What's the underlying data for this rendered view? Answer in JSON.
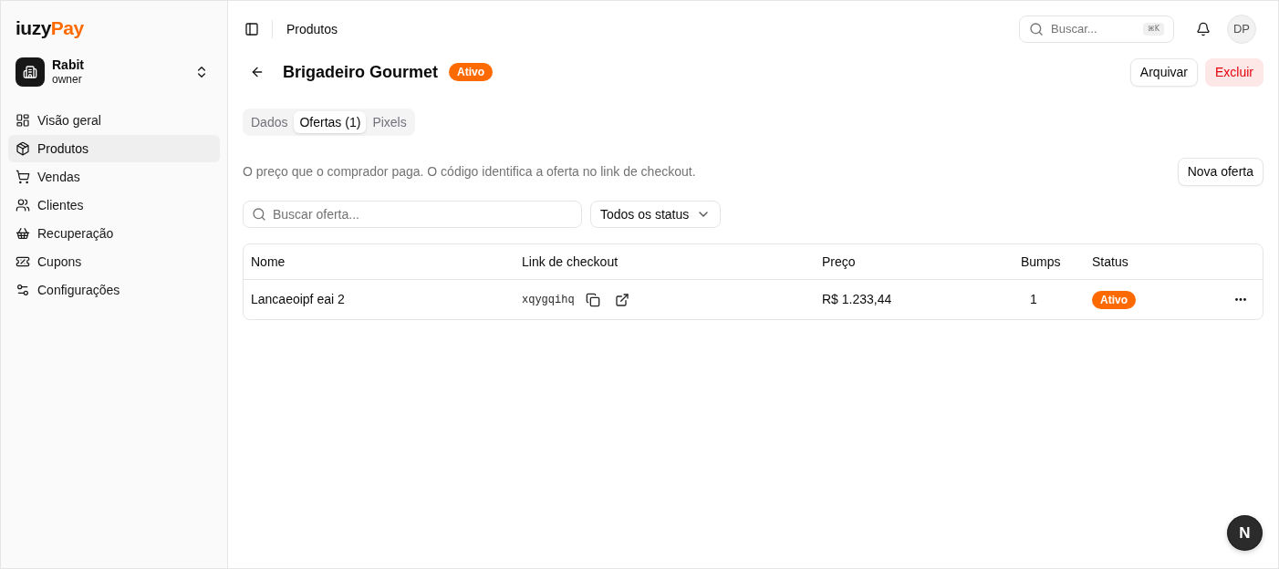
{
  "sidebar": {
    "logo": {
      "text": "iuzy",
      "accent": "Pay"
    },
    "workspace": {
      "name": "Rabit",
      "role": "owner"
    },
    "nav": [
      {
        "label": "Visão geral",
        "selected": false
      },
      {
        "label": "Produtos",
        "selected": true
      },
      {
        "label": "Vendas",
        "selected": false
      },
      {
        "label": "Clientes",
        "selected": false
      },
      {
        "label": "Recuperação",
        "selected": false
      },
      {
        "label": "Cupons",
        "selected": false
      },
      {
        "label": "Configurações",
        "selected": false
      }
    ]
  },
  "header": {
    "breadcrumb": "Produtos",
    "search": {
      "placeholder": "Buscar...",
      "shortcut": "⌘K"
    },
    "avatar": "DP"
  },
  "product": {
    "title": "Brigadeiro Gourmet",
    "status": "Ativo",
    "actions": [
      {
        "label": "Arquivar",
        "kind": "secondary"
      },
      {
        "label": "Excluir",
        "kind": "danger"
      }
    ]
  },
  "tabs": [
    {
      "label": "Dados",
      "selected": false
    },
    {
      "label": "Ofertas (1)",
      "selected": true
    },
    {
      "label": "Pixels",
      "selected": false
    }
  ],
  "offers": {
    "description": "O preço que o comprador paga. O código identifica a oferta no link de checkout.",
    "new_button": "Nova oferta",
    "search": {
      "placeholder": "Buscar oferta..."
    },
    "status_filter": "Todos os status",
    "table": {
      "columns": [
        "Nome",
        "Link de checkout",
        "Preço",
        "Bumps",
        "Status"
      ],
      "rows": [
        {
          "name": "Lancaeoipf eai 2",
          "code": "xqygqihq",
          "price": "R$ 1.233,44",
          "bumps": "1",
          "status": "Ativo"
        }
      ]
    }
  },
  "dev_indicator": {
    "label": "N"
  }
}
